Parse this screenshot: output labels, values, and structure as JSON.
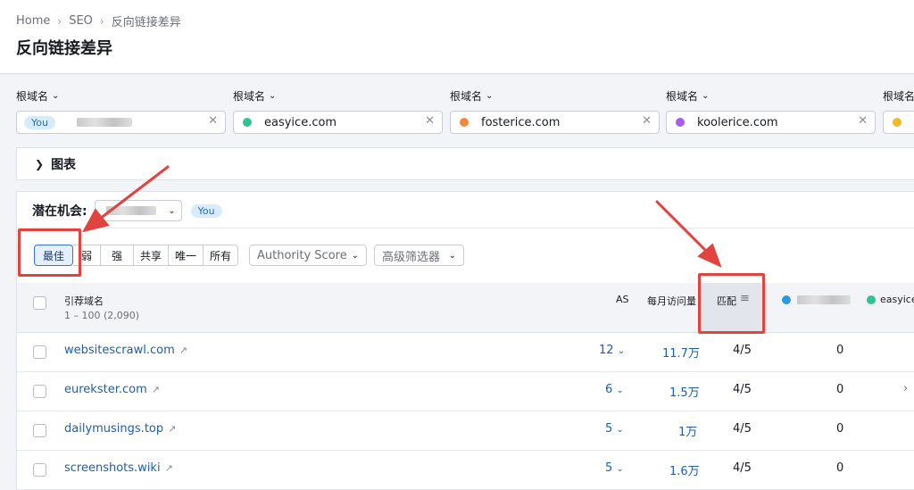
{
  "breadcrumb": [
    "Home",
    "SEO",
    "反向链接差异"
  ],
  "page_title": "反向链接差异",
  "domain_label": "根域名",
  "domains": [
    {
      "value": "",
      "badge": "You",
      "dot": "",
      "blurred": true
    },
    {
      "value": "easyice.com",
      "dot": "#2fc48f"
    },
    {
      "value": "fosterice.com",
      "dot": "#f18a3a"
    },
    {
      "value": "koolerice.com",
      "dot": "#a85de8"
    },
    {
      "value": "",
      "dot": "#f5b82a",
      "partial_label": "根域名"
    }
  ],
  "chart_toggle": "图表",
  "opportunity": {
    "label": "潜在机会:",
    "badge": "You"
  },
  "segments": [
    "最佳",
    "弱",
    "强",
    "共享",
    "唯一",
    "所有"
  ],
  "active_segment": "最佳",
  "filters": {
    "authority": "Authority Score",
    "advanced": "高级筛选器"
  },
  "table": {
    "header": {
      "domain_col": "引荐域名",
      "range": "1 – 100 (2,090)",
      "as": "AS",
      "monthly": "每月访问量",
      "match": "匹配",
      "comp2": "easyice."
    },
    "rows": [
      {
        "domain": "websitescrawl.com",
        "as": "12",
        "visits": "11.7万",
        "match": "4/5",
        "you": "0"
      },
      {
        "domain": "eurekster.com",
        "as": "6",
        "visits": "1.5万",
        "match": "4/5",
        "you": "0"
      },
      {
        "domain": "dailymusings.top",
        "as": "5",
        "visits": "1万",
        "match": "4/5",
        "you": "0"
      },
      {
        "domain": "screenshots.wiki",
        "as": "5",
        "visits": "1.6万",
        "match": "4/5",
        "you": "0"
      }
    ]
  },
  "colors": {
    "accent": "#3d6fd8",
    "link": "#1d5fa8",
    "annotation": "#e1443e",
    "you_dot": "#2a9be0"
  }
}
